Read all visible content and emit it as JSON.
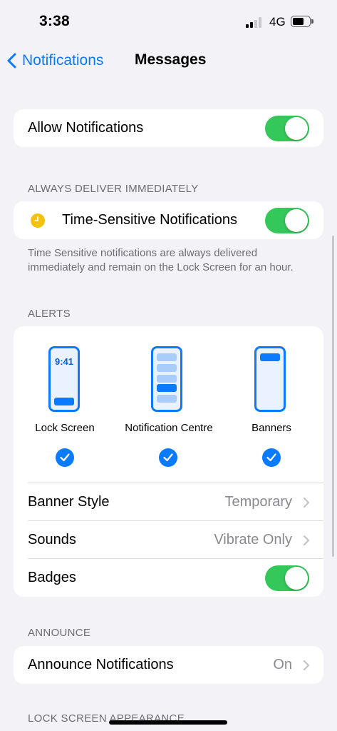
{
  "status_bar": {
    "time": "3:38",
    "network": "4G"
  },
  "nav": {
    "back_label": "Notifications",
    "title": "Messages"
  },
  "allow": {
    "label": "Allow Notifications",
    "on": true
  },
  "deliver": {
    "header": "ALWAYS DELIVER IMMEDIATELY",
    "label": "Time-Sensitive Notifications",
    "on": true,
    "footer": "Time Sensitive notifications are always delivered immediately and remain on the Lock Screen for an hour."
  },
  "alerts": {
    "header": "ALERTS",
    "styles": [
      {
        "label": "Lock Screen",
        "phone_time": "9:41",
        "checked": true
      },
      {
        "label": "Notification Centre",
        "checked": true
      },
      {
        "label": "Banners",
        "checked": true
      }
    ],
    "banner_style": {
      "label": "Banner Style",
      "value": "Temporary"
    },
    "sounds": {
      "label": "Sounds",
      "value": "Vibrate Only"
    },
    "badges": {
      "label": "Badges",
      "on": true
    }
  },
  "announce": {
    "header": "ANNOUNCE",
    "label": "Announce Notifications",
    "value": "On"
  },
  "lock_screen": {
    "header": "LOCK SCREEN APPEARANCE"
  },
  "colors": {
    "accent": "#0a7aff",
    "toggle_on": "#34c759",
    "clock_icon": "#f4c20d"
  }
}
